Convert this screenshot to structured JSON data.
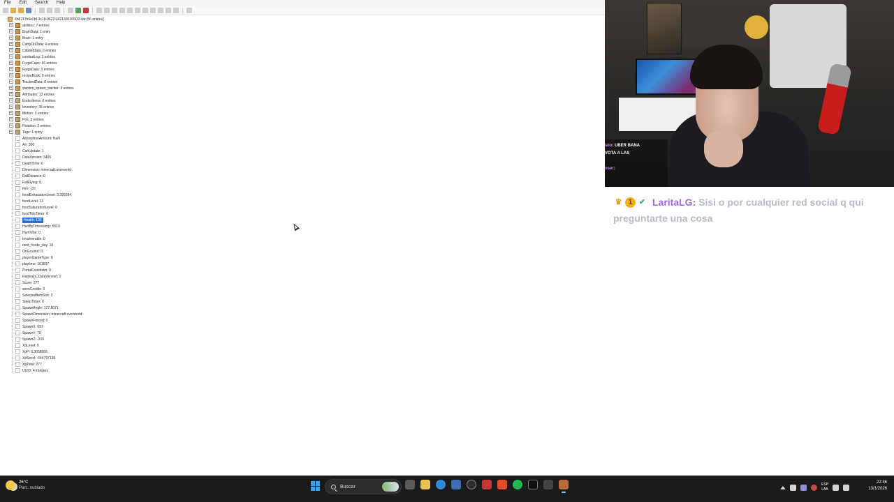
{
  "menu": [
    "File",
    "Edit",
    "Search",
    "Help"
  ],
  "tree": {
    "root": "4b6717b6e0bf-3c19-9622-4421330165D2.dat [56 entries]",
    "nodes": [
      {
        "label": "abilities: 7 entries",
        "kind": "compound"
      },
      {
        "label": "BrainData: 1 entry",
        "kind": "compound"
      },
      {
        "label": "Brain: 1 entry",
        "kind": "compound"
      },
      {
        "label": "CarryOnData: 4 entries",
        "kind": "compound"
      },
      {
        "label": "CitadelData: 0 entries",
        "kind": "compound"
      },
      {
        "label": "combatLog: 3 entries",
        "kind": "compound"
      },
      {
        "label": "ForgeCaps: 16 entries",
        "kind": "compound"
      },
      {
        "label": "ForgeData: 3 entries",
        "kind": "compound"
      },
      {
        "label": "recipeBook: 0 entries",
        "kind": "compound"
      },
      {
        "label": "TrackedData: 0 entries",
        "kind": "compound"
      },
      {
        "label": "warden_spawn_tracker: 3 entries",
        "kind": "compound"
      },
      {
        "label": "Attributes: 13 entries",
        "kind": "list"
      },
      {
        "label": "EnderItems: 0 entries",
        "kind": "list"
      },
      {
        "label": "Inventory: 35 entries",
        "kind": "list"
      },
      {
        "label": "Motion: 3 entries",
        "kind": "list"
      },
      {
        "label": "Pos: 3 entries",
        "kind": "list"
      },
      {
        "label": "Rotation: 2 entries",
        "kind": "list"
      },
      {
        "label": "Tags: 1 entry",
        "kind": "list"
      },
      {
        "label": "AbsorptionAmount: NaN",
        "kind": "tag"
      },
      {
        "label": "Air: 300",
        "kind": "tag"
      },
      {
        "label": "CanUpdate: 1",
        "kind": "tag"
      },
      {
        "label": "DataVersion: 3465",
        "kind": "tag"
      },
      {
        "label": "DeathTime: 0",
        "kind": "tag"
      },
      {
        "label": "Dimension: minecraft:overworld",
        "kind": "tag"
      },
      {
        "label": "FallDistance: 0",
        "kind": "tag"
      },
      {
        "label": "FallFlying: 0",
        "kind": "tag"
      },
      {
        "label": "Fire: -20",
        "kind": "tag"
      },
      {
        "label": "foodExhaustionLevel: 3.399284",
        "kind": "tag"
      },
      {
        "label": "foodLevel: 13",
        "kind": "tag"
      },
      {
        "label": "foodSaturationLevel: 0",
        "kind": "tag"
      },
      {
        "label": "foodTickTimer: 0",
        "kind": "tag"
      },
      {
        "label": "Health: 100",
        "kind": "tag",
        "selected": true
      },
      {
        "label": "HurtByTimestamp: 5519",
        "kind": "tag"
      },
      {
        "label": "HurtTime: 0",
        "kind": "tag"
      },
      {
        "label": "Invulnerable: 0",
        "kind": "tag"
      },
      {
        "label": "next_horde_day: 10",
        "kind": "tag"
      },
      {
        "label": "OnGround: 0",
        "kind": "tag"
      },
      {
        "label": "playerGameType: 0",
        "kind": "tag"
      },
      {
        "label": "playtime: 161607",
        "kind": "tag"
      },
      {
        "label": "PortalCooldown: 0",
        "kind": "tag"
      },
      {
        "label": "Railways_DataVersion: 2",
        "kind": "tag"
      },
      {
        "label": "Score: 277",
        "kind": "tag"
      },
      {
        "label": "seenCredits: 0",
        "kind": "tag"
      },
      {
        "label": "SelectedItemSlot: 2",
        "kind": "tag"
      },
      {
        "label": "SleepTimer: 0",
        "kind": "tag"
      },
      {
        "label": "SpawnAngle: 177.8071",
        "kind": "tag"
      },
      {
        "label": "SpawnDimension: minecraft:overworld",
        "kind": "tag"
      },
      {
        "label": "SpawnForced: 0",
        "kind": "tag"
      },
      {
        "label": "SpawnX: 693",
        "kind": "tag"
      },
      {
        "label": "SpawnY: 70",
        "kind": "tag"
      },
      {
        "label": "SpawnZ: -315",
        "kind": "tag"
      },
      {
        "label": "XpLevel: 0",
        "kind": "tag"
      },
      {
        "label": "XpP: 0.3058066",
        "kind": "tag"
      },
      {
        "label": "XpSeed: -644797135",
        "kind": "tag"
      },
      {
        "label": "XpTotal: 277",
        "kind": "tag"
      },
      {
        "label": "UUID: 4 integers",
        "kind": "tag"
      }
    ]
  },
  "webcam_chat": [
    {
      "user": "lalo",
      "text": ": UBER BANA"
    },
    {
      "user": "",
      "text": "VOTA A LAS"
    },
    {
      "user": "oser",
      "text": ":"
    }
  ],
  "chat": {
    "username": "LaritaLG",
    "line1": "Sisi o por cualquier red social q qui",
    "line2": "preguntarte una cosa"
  },
  "taskbar": {
    "weather_temp": "26°C",
    "weather_desc": "Parc. nublado",
    "search_label": "Buscar",
    "lang_top": "ESP",
    "lang_bottom": "LAA",
    "time": "22:36",
    "date": "13/1/2026"
  }
}
